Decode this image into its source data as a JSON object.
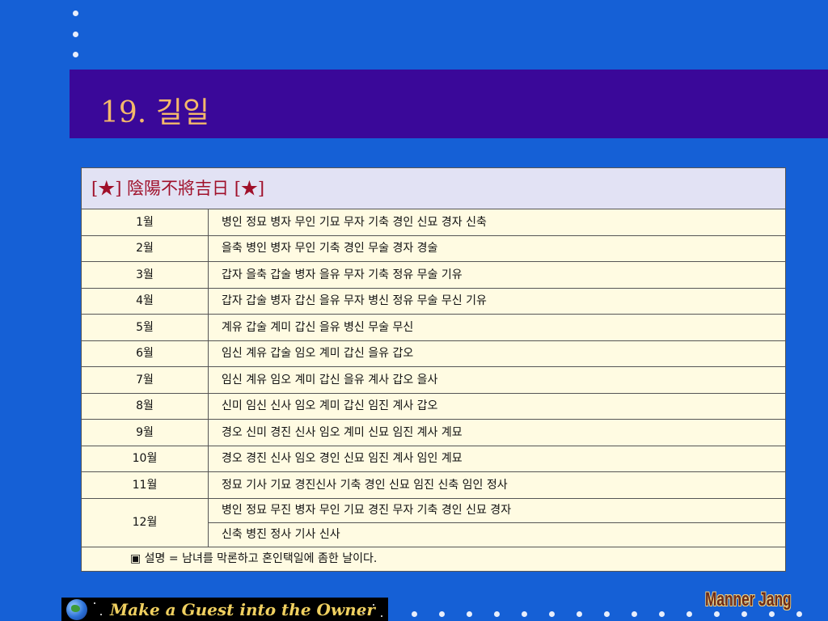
{
  "slide": {
    "title": "19. 길일"
  },
  "table": {
    "header": "[★] 陰陽不將吉日 [★]",
    "rows": [
      {
        "month": "1월",
        "days": "병인 정묘 병자 무인 기묘 무자 기축 경인 신묘 경자 신축"
      },
      {
        "month": "2월",
        "days": "을축 병인 병자 무인 기축 경인 무술 경자 경술"
      },
      {
        "month": "3월",
        "days": "갑자 을축 갑술 병자 을유 무자 기축 정유 무술 기유"
      },
      {
        "month": "4월",
        "days": "갑자 갑술 병자 갑신 을유 무자 병신 정유 무술 무신 기유"
      },
      {
        "month": "5월",
        "days": "계유 갑술 계미 갑신 을유 병신 무술 무신"
      },
      {
        "month": "6월",
        "days": "임신 계유 갑술 임오 계미 갑신 을유 갑오"
      },
      {
        "month": "7월",
        "days": "임신 계유 임오 계미 갑신 을유 계사 갑오 을사"
      },
      {
        "month": "8월",
        "days": "신미 임신 신사 임오 계미 갑신 임진 계사 갑오"
      },
      {
        "month": "9월",
        "days": "경오 신미 경진 신사 임오 계미 신묘 임진 계사 계묘"
      },
      {
        "month": "10월",
        "days": "경오 경진 신사 임오 경인 신묘 임진 계사 임인 계묘"
      },
      {
        "month": "11월",
        "days": "정묘 기사 기묘 경진신사 기축 경인 신묘 임진 신축 임인 정사"
      }
    ],
    "dec": {
      "month": "12월",
      "days_line1": "병인 정묘 무진 병자 무인 기묘 경진 무자 기축 경인 신묘 경자",
      "days_line2": "신축 병진 정사 기사 신사"
    },
    "note": "▣ 설명 = 남녀를 막론하고 혼인택일에 좀한 날이다."
  },
  "footer": {
    "banner_text": "Make a Guest into the Owner",
    "signature": "Manner Jang"
  },
  "colors": {
    "background": "#1560d6",
    "title_band": "#3a0899",
    "title_text": "#f4b96a",
    "header_text": "#a0102a",
    "cell_bg": "#fffbe2"
  }
}
